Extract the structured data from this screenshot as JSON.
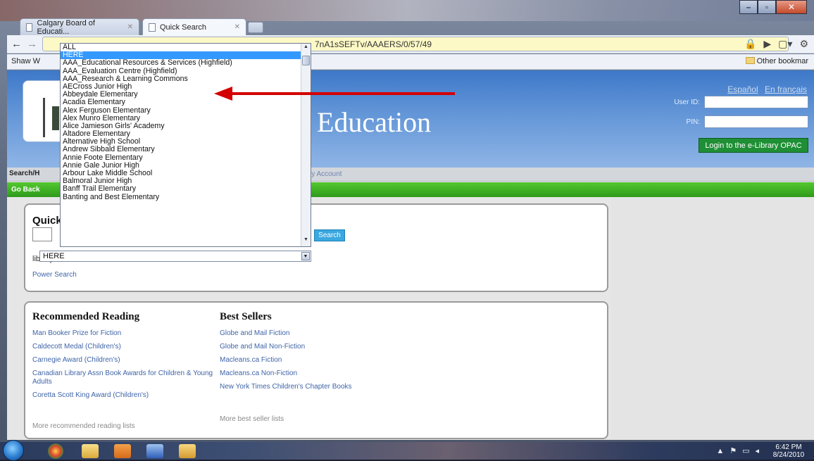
{
  "browser": {
    "tabs": [
      {
        "label": "Calgary Board of Educati..."
      },
      {
        "label": "Quick Search"
      }
    ],
    "url_fragment": "7nA1sSEFTv/AAAERS/0/57/49",
    "bookmark_left": "Shaw W",
    "bookmark_other": "Other bookmar"
  },
  "header": {
    "title": "Education",
    "lang_es": "Español",
    "lang_fr": "En français",
    "user_id_label": "User ID:",
    "pin_label": "PIN:",
    "login_button": "Login to the e-Library OPAC"
  },
  "nav": {
    "search_label": "Search/H",
    "my_account": "ly Account",
    "go_back": "Go Back"
  },
  "quick_search": {
    "title": "Quick",
    "search_button": "Search",
    "library_label": "library:",
    "library_value": "HERE",
    "power_search": "Power Search"
  },
  "library_dropdown": {
    "options": [
      "ALL",
      "HERE",
      "AAA_Educational Resources & Services (Highfield)",
      "AAA_Evaluation Centre (Highfield)",
      "AAA_Research & Learning Commons",
      "AECross Junior High",
      "Abbeydale Elementary",
      "Acadia Elementary",
      "Alex Ferguson Elementary",
      "Alex Munro Elementary",
      "Alice Jamieson Girls' Academy",
      "Altadore Elementary",
      "Alternative High School",
      "Andrew Sibbald Elementary",
      "Annie Foote Elementary",
      "Annie Gale Junior High",
      "Arbour Lake Middle School",
      "Balmoral Junior High",
      "Banff Trail Elementary",
      "Banting and Best Elementary"
    ],
    "selected": "HERE"
  },
  "recommended": {
    "title": "Recommended Reading",
    "links": [
      "Man Booker Prize for Fiction",
      "Caldecott Medal (Children's)",
      "Carnegie Award (Children's)",
      "Canadian Library Assn Book Awards for Children & Young Adults",
      "Coretta Scott King Award (Children's)"
    ],
    "more": "More recommended reading lists"
  },
  "best_sellers": {
    "title": "Best Sellers",
    "links": [
      "Globe and Mail Fiction",
      "Globe and Mail Non-Fiction",
      "Macleans.ca Fiction",
      "Macleans.ca Non-Fiction",
      "New York Times Children's Chapter Books"
    ],
    "more": "More best seller lists"
  },
  "taskbar": {
    "time": "6:42 PM",
    "date": "8/24/2010"
  },
  "colors": {
    "header_blue": "#3d78c8",
    "green_bar": "#3aa81f",
    "login_green": "#1f8f35",
    "selection_blue": "#3399ff",
    "annotation_red": "#d40000"
  },
  "icons": [
    "new-tab-icon",
    "back-arrow-icon",
    "forward-arrow-icon",
    "lock-icon",
    "page-menu-icon",
    "wrench-icon",
    "folder-icon",
    "start-orb-icon",
    "chrome-icon",
    "explorer-icon",
    "media-player-icon",
    "word-icon",
    "outlook-icon"
  ]
}
